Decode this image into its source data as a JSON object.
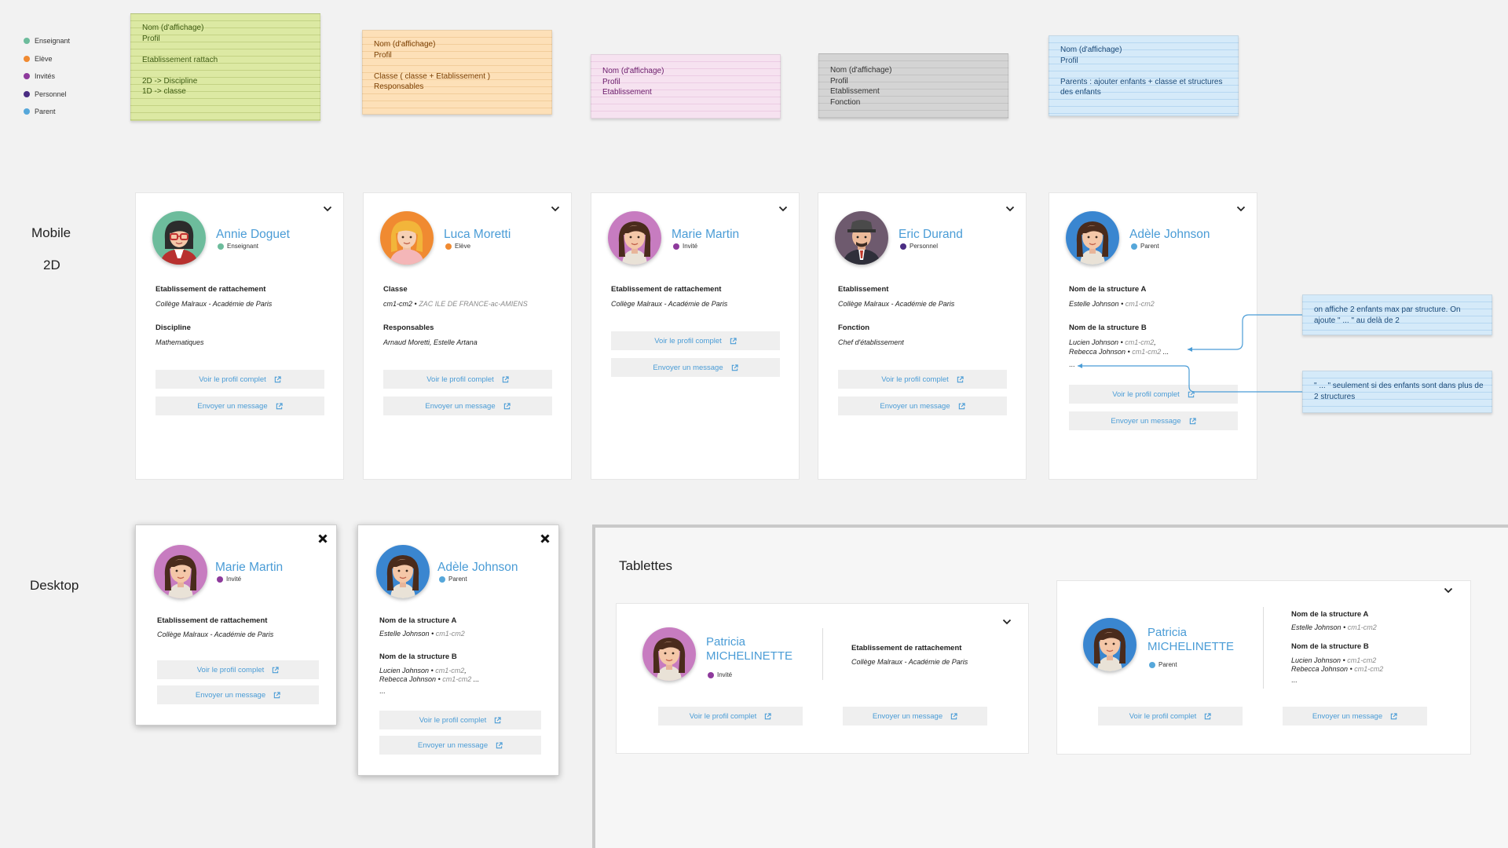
{
  "legend": [
    {
      "label": "Enseignant",
      "color": "#6dbc9c"
    },
    {
      "label": "Elève",
      "color": "#f08a31"
    },
    {
      "label": "Invités",
      "color": "#8e3a9c"
    },
    {
      "label": "Personnel",
      "color": "#4a2d83"
    },
    {
      "label": "Parent",
      "color": "#56a7da"
    }
  ],
  "notes": {
    "yellow": [
      "Nom (d'affichage)",
      "Profil",
      "",
      "Etablissement rattach",
      "",
      "2D -> Discipline",
      "1D -> classe"
    ],
    "orange": [
      "Nom (d'affichage)",
      "Profil",
      "",
      "Classe ( classe + Etablissement )",
      "Responsables"
    ],
    "pink": [
      "Nom (d'affichage)",
      "Profil",
      "Etablissement"
    ],
    "gray": [
      "Nom (d'affichage)",
      "Profil",
      "Etablissement",
      "Fonction"
    ],
    "blue": [
      "Nom (d'affichage)",
      "Profil",
      "",
      "Parents : ajouter enfants + classe et structures",
      "des enfants"
    ],
    "side1": [
      "on affiche 2 enfants max par structure. On",
      "ajoute \" ... \" au delà de 2"
    ],
    "side2": [
      "\" ... \" seulement si des enfants sont dans plus de",
      "2 structures"
    ]
  },
  "sections": {
    "mobile": "Mobile",
    "mobile_sub": "2D",
    "desktop": "Desktop",
    "tablets": "Tablettes"
  },
  "actions": {
    "profile": "Voir le profil complet",
    "message": "Envoyer un message"
  },
  "cards": {
    "annie": {
      "name": "Annie Doguet",
      "role": "Enseignant",
      "f1_label": "Etablissement de rattachement",
      "f1_value": "Collège Malraux - Académie de Paris",
      "f2_label": "Discipline",
      "f2_value": "Mathematiques"
    },
    "luca": {
      "name": "Luca Moretti",
      "role": "Elève",
      "f1_label": "Classe",
      "f1_value": "cm1-cm2",
      "f1_extra": "ZAC ILE DE FRANCE-ac-AMIENS",
      "f2_label": "Responsables",
      "f2_value": "Arnaud Moretti, Estelle Artana"
    },
    "marie": {
      "name": "Marie Martin",
      "role": "Invité",
      "f1_label": "Etablissement de rattachement",
      "f1_value": "Collège Malraux - Académie de Paris"
    },
    "eric": {
      "name": "Eric Durand",
      "role": "Personnel",
      "f1_label": "Etablissement",
      "f1_value": "Collège Malraux - Académie de Paris",
      "f2_label": "Fonction",
      "f2_value": "Chef d'établissement"
    },
    "adele": {
      "name": "Adèle Johnson",
      "role": "Parent",
      "sa_label": "Nom de la structure A",
      "sa_child": "Estelle Johnson",
      "sa_class": "cm1-cm2",
      "sb_label": "Nom de la structure B",
      "sb_child1": "Lucien Johnson",
      "sb_class1": "cm1-cm2",
      "sb_child2": "Rebecca Johnson",
      "sb_class2": "cm1-cm2",
      "more": "...",
      "comma": ","
    },
    "patricia1": {
      "name": "Patricia MICHELINETTE",
      "role": "Invité",
      "f1_label": "Etablissement de rattachement",
      "f1_value": "Collège Malraux - Académie de Paris"
    },
    "patricia2": {
      "name": "Patricia MICHELINETTE",
      "role": "Parent",
      "sa_label": "Nom de la structure A",
      "sa_child": "Estelle Johnson",
      "sa_class": "cm1-cm2",
      "sb_label": "Nom de la structure B",
      "sb_child1": "Lucien Johnson",
      "sb_class1": "cm1-cm2",
      "sb_child2": "Rebecca Johnson",
      "sb_class2": "cm1-cm2",
      "more": "..."
    }
  },
  "icons": {
    "expand": "chevron-down-icon",
    "close": "close-icon",
    "external": "external-link-icon",
    "bullet": "•"
  },
  "colors": {
    "link": "#4a9cd6",
    "button_bg": "#efefef",
    "connector": "#4a9cd6"
  }
}
